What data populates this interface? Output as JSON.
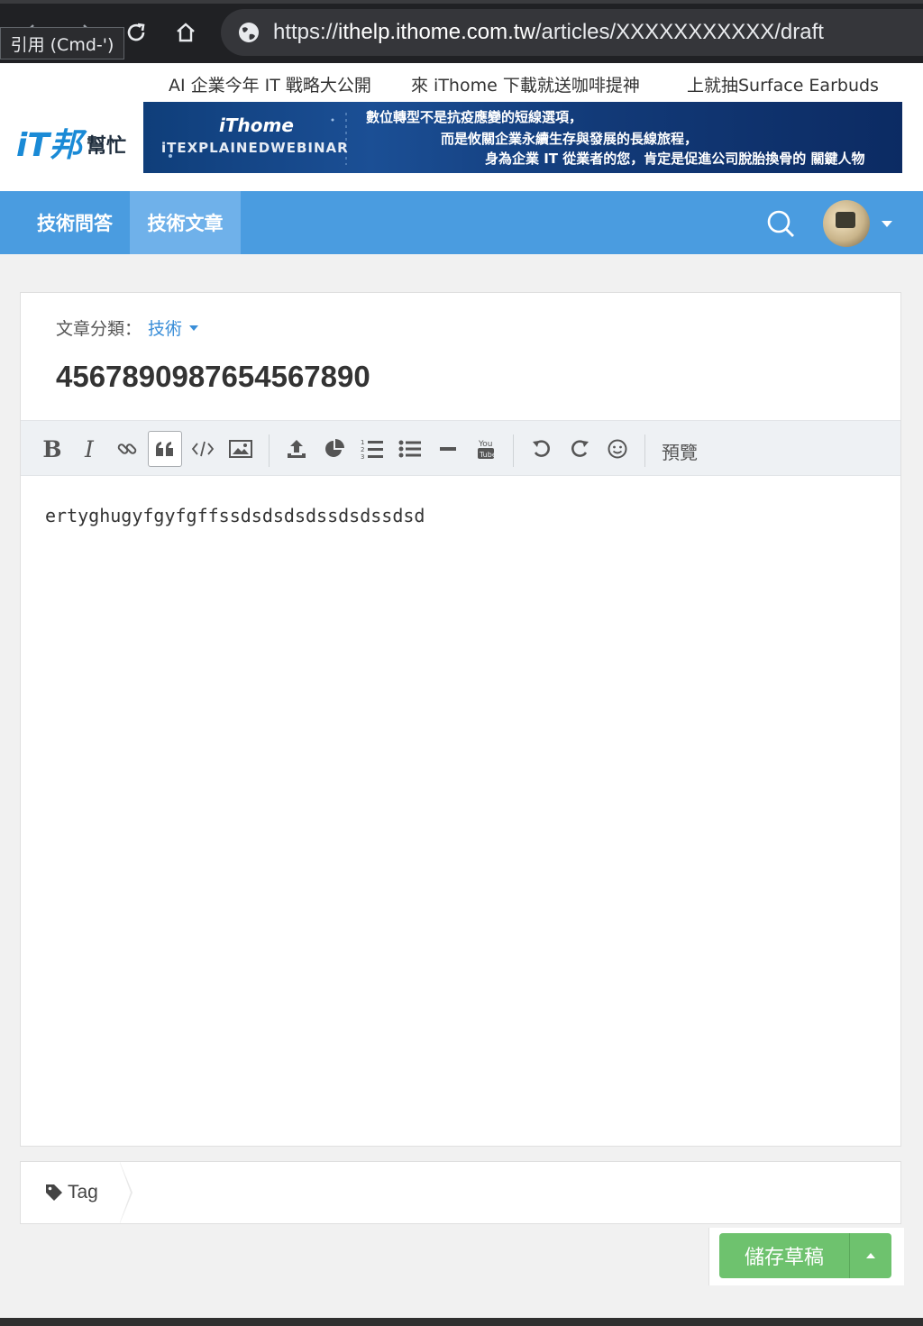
{
  "browser": {
    "url_scheme": "https://",
    "url_host": "ithelp.ithome.com.tw",
    "url_path": "/articles/XXXXXXXXXXX/draft",
    "tooltip": "引用 (Cmd-')"
  },
  "header": {
    "top_links": [
      "AI 企業今年 IT 戰略大公開",
      "來 iThome 下載就送咖啡提神",
      "上就抽Surface Earbuds"
    ],
    "logo_text_main": "iT邦",
    "logo_text_sub": "幫忙",
    "banner": {
      "brand": "iThome",
      "subbrand": "iTEXPLAINEDWEBINAR",
      "line1": "數位轉型不是抗疫應變的短線選項，",
      "line2": "而是攸關企業永續生存與發展的長線旅程，",
      "line3": "身為企業 IT 從業者的您，肯定是促進公司脫胎換骨的 關鍵人物"
    }
  },
  "nav": {
    "tabs": [
      {
        "label": "技術問答",
        "active": false
      },
      {
        "label": "技術文章",
        "active": true
      }
    ]
  },
  "editor": {
    "category_label": "文章分類：",
    "category_value": "技術",
    "title": "4567890987654567890",
    "body": "ertyghugyfgyfgffssdsdsdsdssdsdssdsd",
    "preview_label": "預覽"
  },
  "tags": {
    "label": "Tag",
    "value": ""
  },
  "actions": {
    "save_label": "儲存草稿"
  },
  "colors": {
    "nav_bg": "#4a9ce0",
    "nav_active": "#6fb1ea",
    "save_green": "#6ec26e",
    "category_blue": "#3a8ed8"
  }
}
